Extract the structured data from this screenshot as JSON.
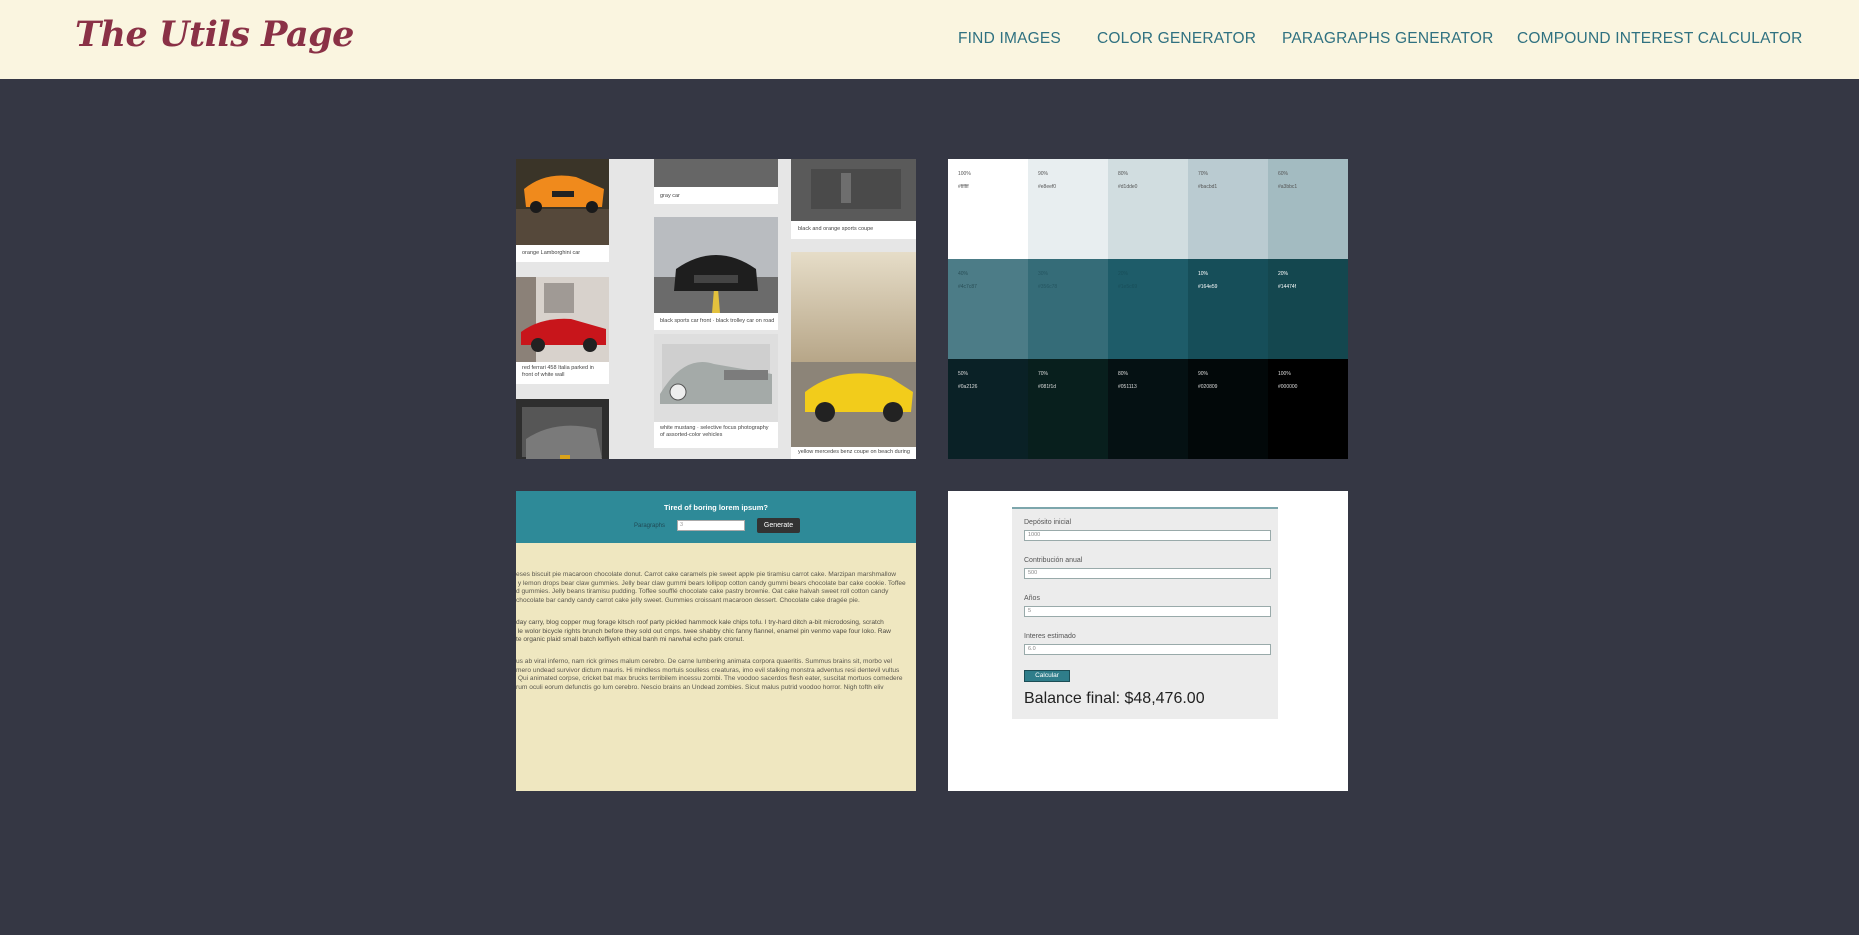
{
  "header": {
    "logo": "The Utils Page",
    "nav": [
      "FIND IMAGES",
      "COLOR GENERATOR",
      "PARAGRAPHS GENERATOR",
      "COMPOUND INTEREST CALCULATOR"
    ]
  },
  "cards": {
    "images": {
      "captions": [
        "orange Lamborghini car",
        "gray car",
        "black and orange sports coupe",
        "black sports car front · black trolley car on road",
        "red ferrari 458 Italia parked in front of white wall",
        "white mustang · selective focus photography of assorted-color vehicles",
        "yellow mercedes benz coupe on beach during"
      ]
    },
    "colors": {
      "swatches": [
        {
          "pct": "100%",
          "hex": "#ffffff",
          "color": "#ffffff",
          "text": "#555555"
        },
        {
          "pct": "90%",
          "hex": "#e8eef0",
          "color": "#e8eef0",
          "text": "#555555"
        },
        {
          "pct": "80%",
          "hex": "#d1dde0",
          "color": "#d1dde0",
          "text": "#555555"
        },
        {
          "pct": "70%",
          "hex": "#bacbd1",
          "color": "#bacbd1",
          "text": "#555555"
        },
        {
          "pct": "60%",
          "hex": "#a3bbc1",
          "color": "#a3bbc1",
          "text": "#555555"
        },
        {
          "pct": "40%",
          "hex": "#4c7c87",
          "color": "#4c7c87",
          "text": "#2a4f57"
        },
        {
          "pct": "30%",
          "hex": "#356c78",
          "color": "#356c78",
          "text": "#255560"
        },
        {
          "pct": "20%",
          "hex": "#1e5c69",
          "color": "#1e5c69",
          "text": "#194e59"
        },
        {
          "pct": "10%",
          "hex": "#164e59",
          "color": "#164e59",
          "text": "#ffffff"
        },
        {
          "pct": "20%",
          "hex": "#14474f",
          "color": "#14474f",
          "text": "#ffffff"
        },
        {
          "pct": "50%",
          "hex": "#0a2126",
          "color": "#0a2126",
          "text": "#dddddd"
        },
        {
          "pct": "70%",
          "hex": "#081f1d",
          "color": "#081f1d",
          "text": "#dddddd"
        },
        {
          "pct": "80%",
          "hex": "#051113",
          "color": "#051113",
          "text": "#dddddd"
        },
        {
          "pct": "90%",
          "hex": "#020809",
          "color": "#020809",
          "text": "#dddddd"
        },
        {
          "pct": "100%",
          "hex": "#000000",
          "color": "#000000",
          "text": "#dddddd"
        }
      ]
    },
    "paragraphs": {
      "title": "Tired of boring lorem ipsum?",
      "label": "Paragraphs",
      "input_value": "3",
      "button": "Generate",
      "p1": "eses biscuit pie macaroon chocolate donut. Carrot cake caramels pie sweet apple pie tiramisu carrot cake. Marzipan marshmallow\n y lemon drops bear claw gummies. Jelly bear claw gummi bears lollipop cotton candy gummi bears chocolate bar cake cookie. Toffee\nd gummies. Jelly beans tiramisu pudding. Toffee soufflé chocolate cake pastry brownie. Oat cake halvah sweet roll cotton candy\nchocolate bar candy candy carrot cake jelly sweet. Gummies croissant macaroon dessert. Chocolate cake dragée pie.",
      "p2": "day carry, blog copper mug forage kitsch roof party pickled hammock kale chips tofu. I try-hard ditch a-bit microdosing, scratch\n le wolor bicycle rights brunch before they sold out cmps. twee shabby chic fanny flannel, enamel pin venmo vape four loko. Raw\nte organic plaid small batch keffiyeh ethical banh mi narwhal echo park cronut.",
      "p3": "us ab viral inferno, nam rick grimes malum cerebro. De carne lumbering animata corpora quaeritis. Summus brains sit, morbo vel\nmero undead survivor dictum mauris. Hi mindless mortuis soulless creaturas, imo evil stalking monstra adventus resi dentevil vultus\n Qui animated corpse, cricket bat max brucks terribilem incessu zombi. The voodoo sacerdos flesh eater, suscitat mortuos comedere\nrum oculi eorum defunctis go lum cerebro. Nescio brains an Undead zombies. Sicut malus putrid voodoo horror. Nigh tofth eliv"
    },
    "calculator": {
      "fields": [
        {
          "label": "Depósito inicial",
          "value": "1000"
        },
        {
          "label": "Contribución anual",
          "value": "500"
        },
        {
          "label": "Años",
          "value": "5"
        },
        {
          "label": "Interes estimado",
          "value": "6.0"
        }
      ],
      "button": "Calcular",
      "result": "Balance final: $48,476.00"
    }
  },
  "colors": {
    "background": "#353744",
    "header_bg": "#faf5e0",
    "logo": "#8a3146",
    "nav": "#2f7180"
  }
}
